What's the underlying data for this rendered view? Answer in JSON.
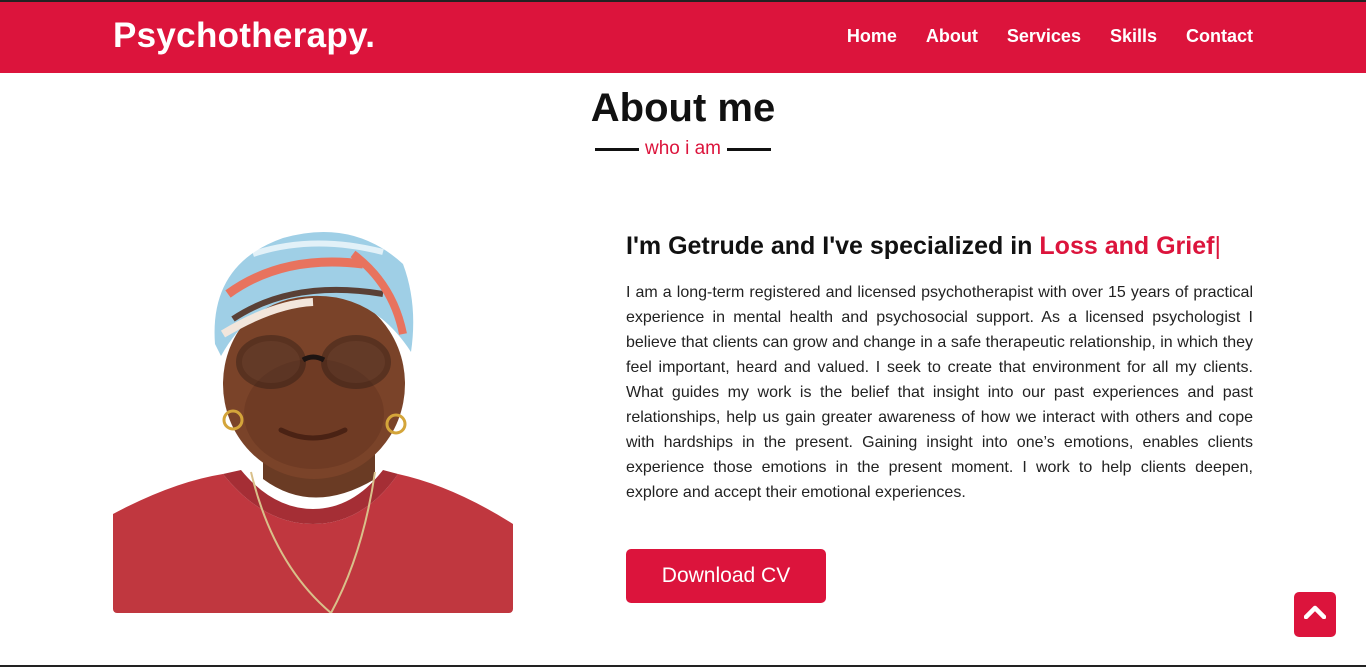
{
  "navbar": {
    "logo": "Psychotherapy.",
    "links": [
      {
        "label": "Home"
      },
      {
        "label": "About"
      },
      {
        "label": "Services"
      },
      {
        "label": "Skills"
      },
      {
        "label": "Contact"
      }
    ],
    "background_color": "#dc143c"
  },
  "about": {
    "title": "About me",
    "subtitle": "who i am",
    "heading_prefix": "I'm Getrude and I've specialized in ",
    "heading_highlight": "Loss and Grief",
    "heading_caret": "|",
    "bio": "I am a long-term registered and licensed psychotherapist with over 15 years of practical experience in mental health and psychosocial support. As a licensed psychologist I believe that clients can grow and change in a safe therapeutic relationship, in which they feel important, heard and valued. I seek to create that environment for all my clients. What guides my work is the belief that insight into our past experiences and past relationships, help us gain greater awareness of how we interact with others and cope with hardships in the present. Gaining insight into one’s emotions, enables clients experience those emotions in the present moment. I work to help clients deepen, explore and accept their emotional experiences.",
    "cv_button": "Download CV"
  },
  "scroll_top": {
    "icon": "chevron-up-icon"
  },
  "colors": {
    "accent": "#dc143c",
    "text": "#111111",
    "background": "#ffffff"
  }
}
